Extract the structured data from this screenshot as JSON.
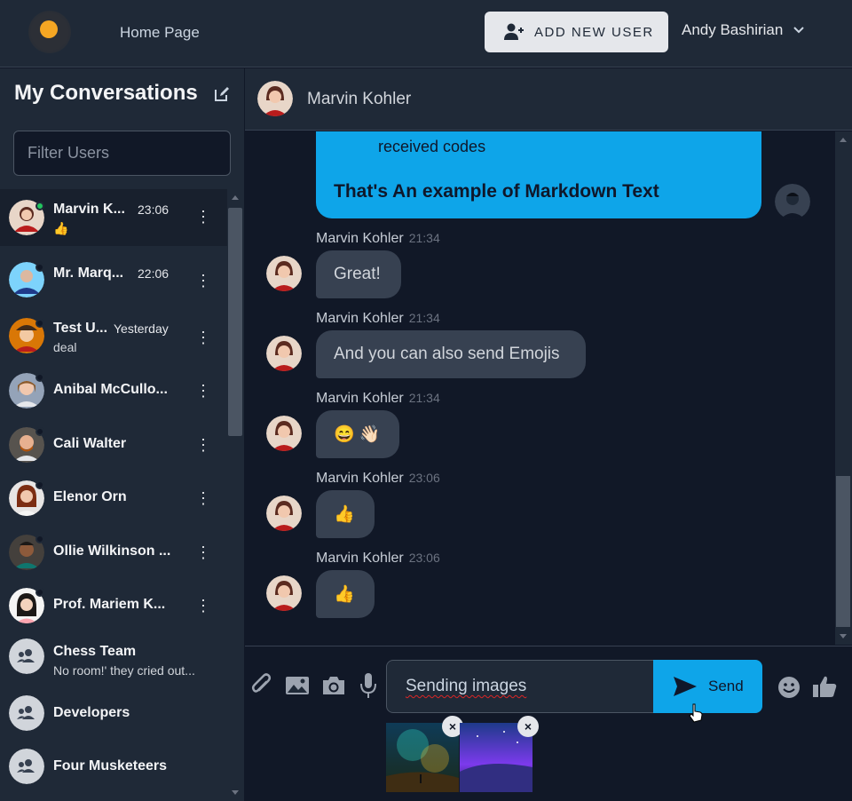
{
  "header": {
    "home_label": "Home Page",
    "add_user_label": "ADD NEW USER",
    "user_name": "Andy Bashirian"
  },
  "sidebar": {
    "title": "My Conversations",
    "filter_placeholder": "Filter Users",
    "conversations": [
      {
        "name": "Marvin K...",
        "time": "23:06",
        "sub": "👍",
        "status": "online"
      },
      {
        "name": "Mr. Marq...",
        "time": "22:06",
        "sub": "",
        "status": "offline"
      },
      {
        "name": "Test U...",
        "time": "Yesterday",
        "sub": "deal",
        "status": "offline"
      },
      {
        "name": "Anibal McCullo...",
        "time": "",
        "sub": "",
        "status": "offline"
      },
      {
        "name": "Cali Walter",
        "time": "",
        "sub": "",
        "status": "offline"
      },
      {
        "name": "Elenor Orn",
        "time": "",
        "sub": "",
        "status": "offline"
      },
      {
        "name": "Ollie Wilkinson ...",
        "time": "",
        "sub": "",
        "status": "offline"
      },
      {
        "name": "Prof. Mariem K...",
        "time": "",
        "sub": "",
        "status": "offline"
      },
      {
        "name": "Chess Team",
        "time": "",
        "sub": "No room!' they cried out...",
        "status": "group"
      },
      {
        "name": "Developers",
        "time": "",
        "sub": "",
        "status": "group"
      },
      {
        "name": "Four Musketeers",
        "time": "",
        "sub": "",
        "status": "group"
      }
    ]
  },
  "chat": {
    "contact_name": "Marvin Kohler",
    "outgoing": {
      "line1": "received codes",
      "line2": "That's An example of Markdown Text"
    },
    "messages": [
      {
        "sender": "Marvin Kohler",
        "time": "21:34",
        "text": "Great!"
      },
      {
        "sender": "Marvin Kohler",
        "time": "21:34",
        "text": "And you can also send Emojis"
      },
      {
        "sender": "Marvin Kohler",
        "time": "21:34",
        "text": "😄 👋🏻"
      },
      {
        "sender": "Marvin Kohler",
        "time": "23:06",
        "text": "👍"
      },
      {
        "sender": "Marvin Kohler",
        "time": "23:06",
        "text": "👍"
      }
    ]
  },
  "composer": {
    "input_value": "Sending images",
    "send_label": "Send",
    "remove_label": "×",
    "icons": [
      "paperclip-icon",
      "image-icon",
      "camera-icon",
      "microphone-icon",
      "smiley-icon",
      "thumbs-up-icon"
    ]
  },
  "colors": {
    "accent": "#0ea5e9",
    "background": "#111827",
    "panel": "#1f2937",
    "bubble_in": "#374151",
    "online": "#22c55e"
  }
}
